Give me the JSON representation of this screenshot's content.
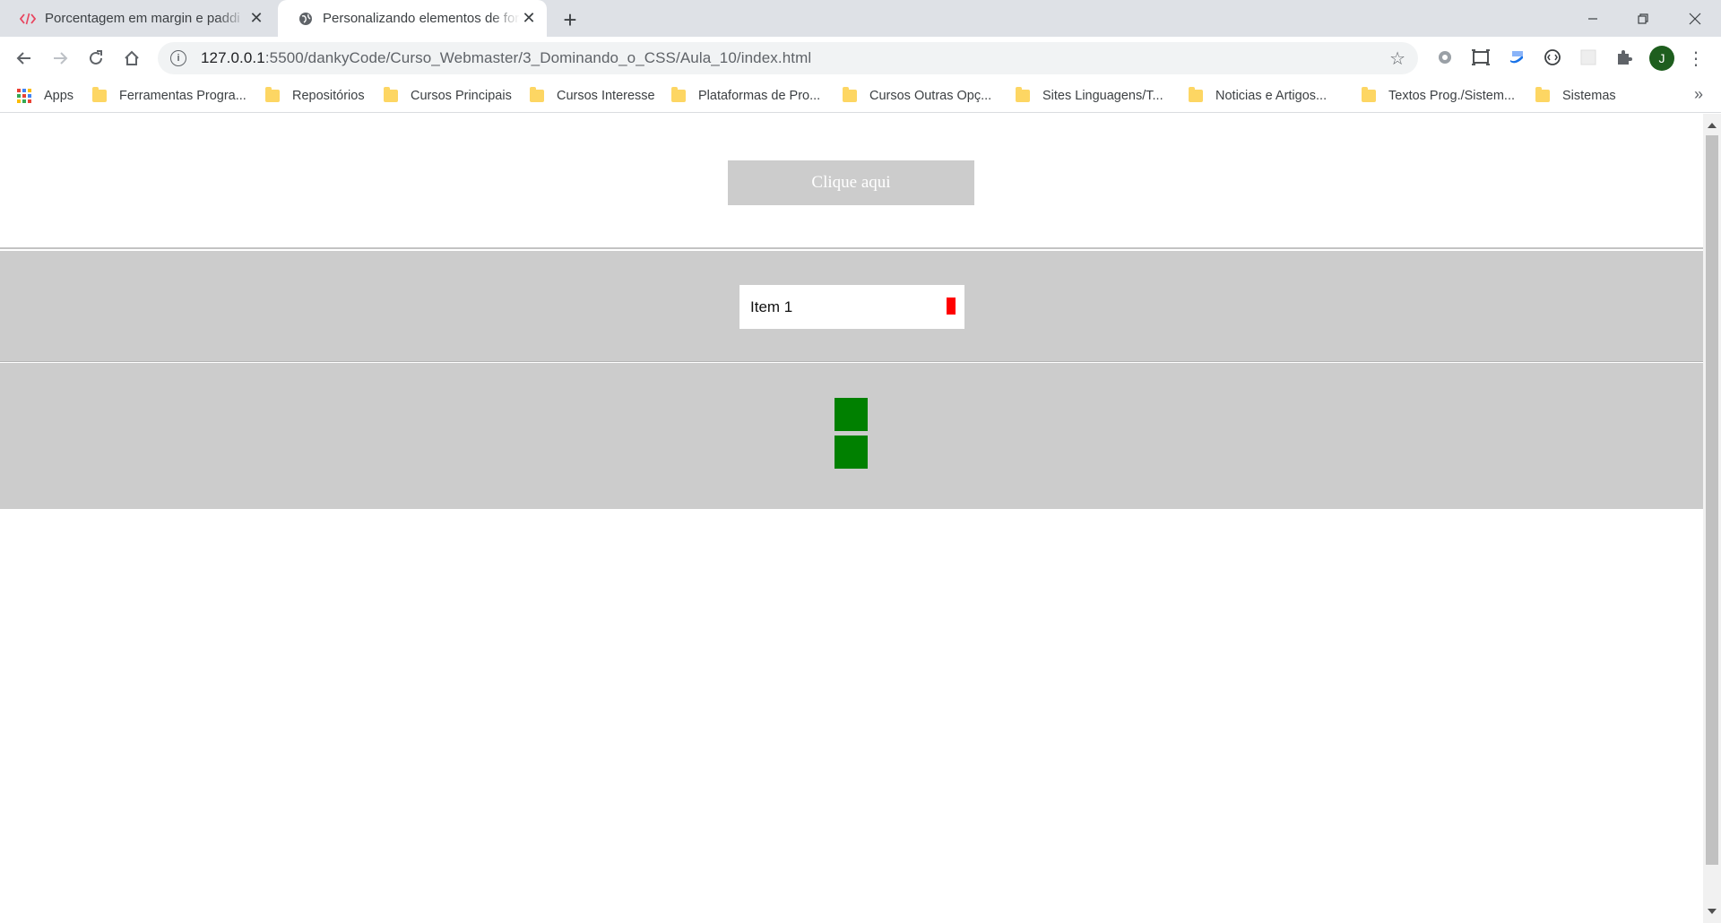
{
  "browser": {
    "tabs": [
      {
        "title": "Porcentagem em margin e paddi",
        "favicon": "code-icon",
        "active": false
      },
      {
        "title": "Personalizando elementos de for",
        "favicon": "globe-icon",
        "active": true
      }
    ],
    "new_tab_symbol": "+",
    "url_host": "127.0.0.1",
    "url_path": ":5500/dankyCode/Curso_Webmaster/3_Dominando_o_CSS/Aula_10/index.html",
    "avatar_initial": "J",
    "bookmarks": {
      "apps_label": "Apps",
      "items": [
        "Ferramentas Progra...",
        "Repositórios",
        "Cursos Principais",
        "Cursos Interesse",
        "Plataformas de Pro...",
        "Cursos Outras Opç...",
        "Sites Linguagens/T...",
        "Noticias e Artigos...",
        "Textos Prog./Sistem...",
        "Sistemas"
      ],
      "more_symbol": "»"
    }
  },
  "page": {
    "button_label": "Clique aqui",
    "select_value": "Item 1",
    "colors": {
      "button_bg": "#cccccc",
      "section_bg": "#cccccc",
      "select_arrow": "#ff0000",
      "squares": "#008000"
    }
  }
}
